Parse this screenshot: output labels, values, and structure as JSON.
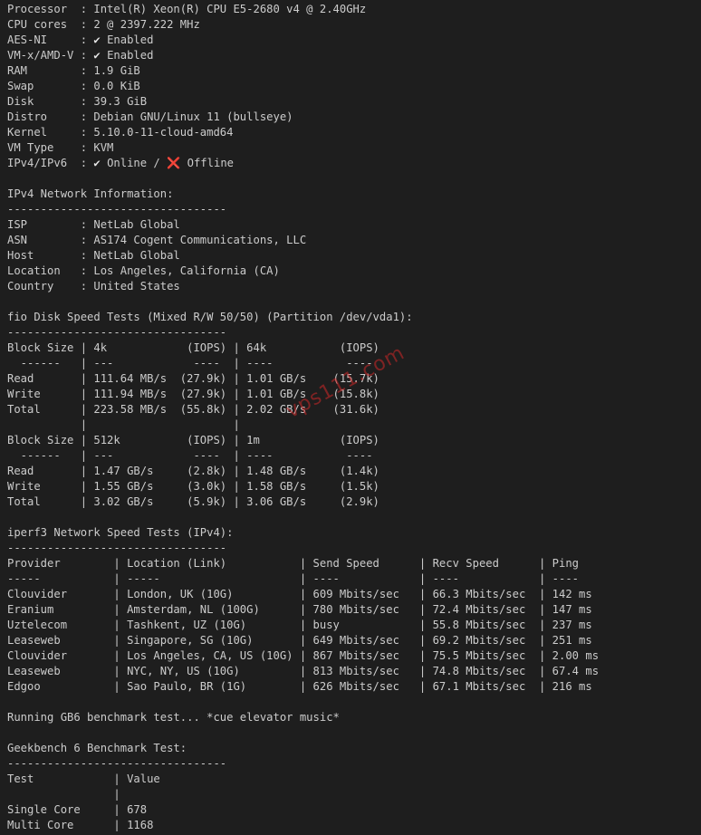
{
  "terminal": {
    "lines": [
      "Processor  : Intel(R) Xeon(R) CPU E5-2680 v4 @ 2.40GHz",
      "CPU cores  : 2 @ 2397.222 MHz",
      "AES-NI     : ✔ Enabled",
      "VM-x/AMD-V : ✔ Enabled",
      "RAM        : 1.9 GiB",
      "Swap       : 0.0 KiB",
      "Disk       : 39.3 GiB",
      "Distro     : Debian GNU/Linux 11 (bullseye)",
      "Kernel     : 5.10.0-11-cloud-amd64",
      "VM Type    : KVM",
      "IPv4/IPv6  : ✔ Online / ❌ Offline",
      "",
      "IPv4 Network Information:",
      "---------------------------------",
      "ISP        : NetLab Global",
      "ASN        : AS174 Cogent Communications, LLC",
      "Host       : NetLab Global",
      "Location   : Los Angeles, California (CA)",
      "Country    : United States",
      "",
      "fio Disk Speed Tests (Mixed R/W 50/50) (Partition /dev/vda1):",
      "---------------------------------",
      "Block Size | 4k            (IOPS) | 64k           (IOPS)",
      "  ------   | ---            ----  | ----           ----",
      "Read       | 111.64 MB/s  (27.9k) | 1.01 GB/s    (15.7k)",
      "Write      | 111.94 MB/s  (27.9k) | 1.01 GB/s    (15.8k)",
      "Total      | 223.58 MB/s  (55.8k) | 2.02 GB/s    (31.6k)",
      "           |                      |",
      "Block Size | 512k          (IOPS) | 1m            (IOPS)",
      "  ------   | ---            ----  | ----           ----",
      "Read       | 1.47 GB/s     (2.8k) | 1.48 GB/s     (1.4k)",
      "Write      | 1.55 GB/s     (3.0k) | 1.58 GB/s     (1.5k)",
      "Total      | 3.02 GB/s     (5.9k) | 3.06 GB/s     (2.9k)",
      "",
      "iperf3 Network Speed Tests (IPv4):",
      "---------------------------------",
      "Provider        | Location (Link)           | Send Speed      | Recv Speed      | Ping",
      "-----           | -----                     | ----            | ----            | ----",
      "Clouvider       | London, UK (10G)          | 609 Mbits/sec   | 66.3 Mbits/sec  | 142 ms",
      "Eranium         | Amsterdam, NL (100G)      | 780 Mbits/sec   | 72.4 Mbits/sec  | 147 ms",
      "Uztelecom       | Tashkent, UZ (10G)        | busy            | 55.8 Mbits/sec  | 237 ms",
      "Leaseweb        | Singapore, SG (10G)       | 649 Mbits/sec   | 69.2 Mbits/sec  | 251 ms",
      "Clouvider       | Los Angeles, CA, US (10G) | 867 Mbits/sec   | 75.5 Mbits/sec  | 2.00 ms",
      "Leaseweb        | NYC, NY, US (10G)         | 813 Mbits/sec   | 74.8 Mbits/sec  | 67.4 ms",
      "Edgoo           | Sao Paulo, BR (1G)        | 626 Mbits/sec   | 67.1 Mbits/sec  | 216 ms",
      "",
      "Running GB6 benchmark test... *cue elevator music*",
      "",
      "Geekbench 6 Benchmark Test:",
      "---------------------------------",
      "Test            | Value",
      "                |",
      "Single Core     | 678",
      "Multi Core      | 1168"
    ]
  },
  "watermark": {
    "text": "vps111.com"
  },
  "colors": {
    "background": "#1e1e1e",
    "text": "#cccccc",
    "cross": "#f14c4c",
    "watermark": "#cd2828"
  }
}
